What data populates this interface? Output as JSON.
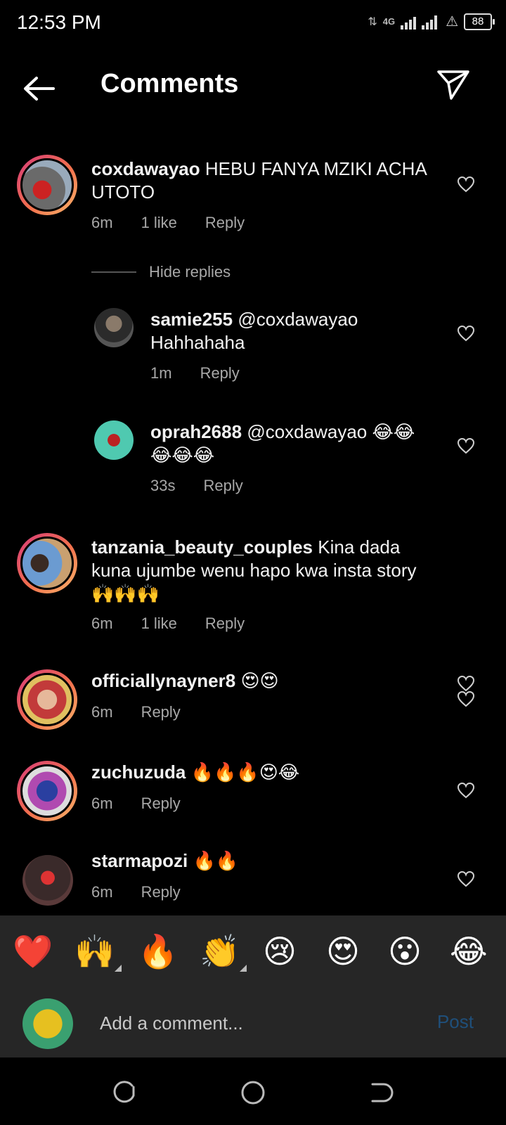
{
  "status_bar": {
    "time": "12:53 PM",
    "network": "4G",
    "battery": "88"
  },
  "header": {
    "title": "Comments"
  },
  "comments": [
    {
      "username": "coxdawayao",
      "text": "HEBU FANYA MZIKI ACHA UTOTO",
      "time": "6m",
      "likes": "1 like",
      "reply": "Reply",
      "replies_toggle": "Hide replies",
      "replies": [
        {
          "username": "samie255",
          "text": "@coxdawayao Hahhahaha",
          "time": "1m",
          "reply": "Reply"
        },
        {
          "username": "oprah2688",
          "text": "@coxdawayao 😂😂😂😂😂",
          "time": "33s",
          "reply": "Reply"
        }
      ]
    },
    {
      "username": "tanzania_beauty_couples",
      "text": "Kina dada kuna ujumbe wenu hapo kwa insta story 🙌🙌🙌",
      "time": "6m",
      "likes": "1 like",
      "reply": "Reply"
    },
    {
      "username": "officiallynayner8",
      "text": "😍😍",
      "time": "6m",
      "reply": "Reply"
    },
    {
      "username": "zuchuzuda",
      "text": "🔥🔥🔥😍😂",
      "time": "6m",
      "reply": "Reply"
    },
    {
      "username": "starmapozi",
      "text": "🔥🔥",
      "time": "6m",
      "reply": "Reply"
    }
  ],
  "emoji_bar": [
    "❤️",
    "🙌",
    "🔥",
    "👏",
    "😢",
    "😍",
    "😮",
    "😂"
  ],
  "composer": {
    "placeholder": "Add a comment...",
    "post_label": "Post"
  }
}
